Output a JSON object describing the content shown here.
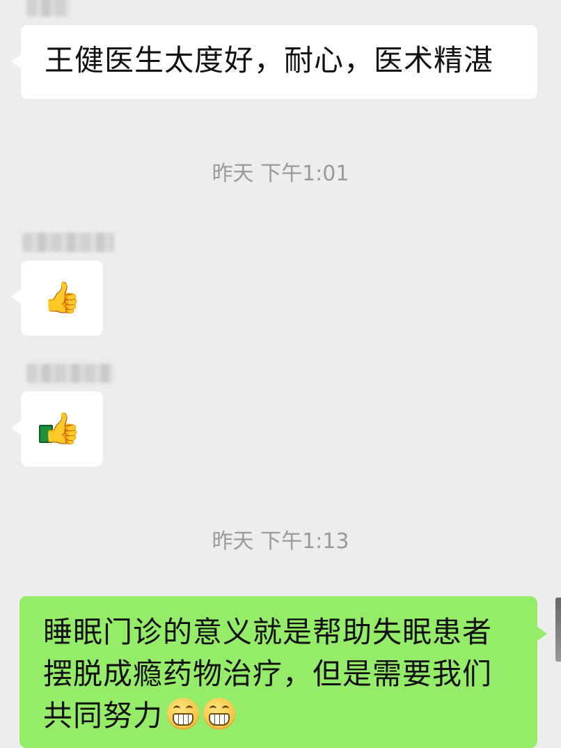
{
  "messages": [
    {
      "type": "text",
      "text": "王健医生太度好，耐心，医术精湛"
    },
    {
      "type": "time",
      "text": "昨天 下午1:01"
    },
    {
      "type": "emoji",
      "icon": "thumbs-up",
      "glyph": "👍"
    },
    {
      "type": "emoji",
      "icon": "thumbs-up-green-sleeve",
      "glyph": "👍"
    },
    {
      "type": "time",
      "text": "昨天 下午1:13"
    },
    {
      "type": "text-self",
      "lines": [
        "睡眠门诊的意义就是帮助失眠患者",
        "摆脱成瘾药物治疗，但是需要我们",
        "共同努力"
      ],
      "trailing_emojis": [
        "grin-icon",
        "grin-icon"
      ]
    }
  ],
  "colors": {
    "background": "#ededed",
    "bubble_other": "#ffffff",
    "bubble_self": "#95ec69",
    "time_text": "#9a9a9a"
  }
}
